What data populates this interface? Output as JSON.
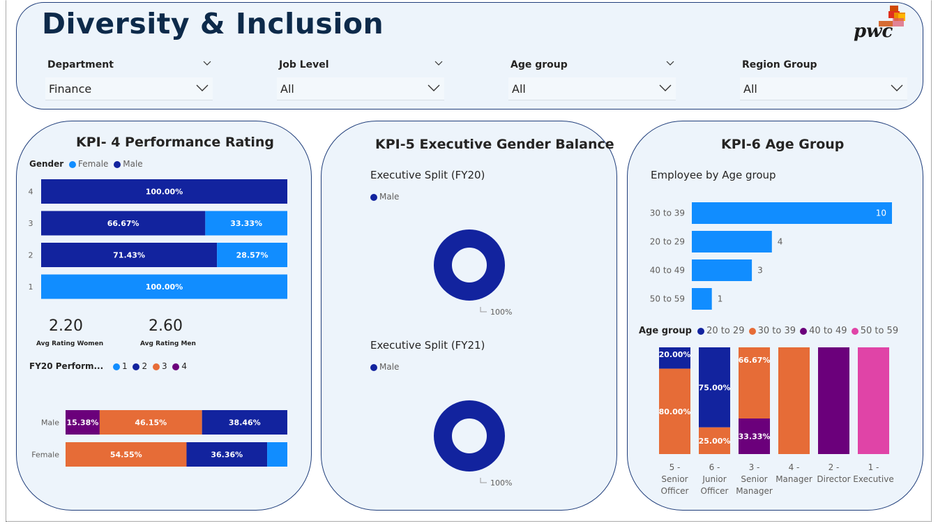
{
  "header": {
    "title": "Diversity & Inclusion",
    "logo_text": "pwc",
    "slicers": [
      {
        "label": "Department",
        "value": "Finance"
      },
      {
        "label": "Job Level",
        "value": "All"
      },
      {
        "label": "Age group",
        "value": "All"
      },
      {
        "label": "Region Group",
        "value": "All"
      }
    ]
  },
  "colors": {
    "female": "#118dff",
    "male": "#12239e",
    "orange": "#e66c37",
    "purple": "#6b007b",
    "pink": "#e044a7",
    "brand_red": "#d04a02",
    "brand_orange": "#eb8c00",
    "brand_yellow": "#ffb600"
  },
  "kpi4": {
    "title": "KPI- 4 Performance Rating",
    "legend_title": "Gender",
    "legend": [
      "Female",
      "Male"
    ],
    "avg_women_value": "2.20",
    "avg_women_label": "Avg Rating Women",
    "avg_men_value": "2.60",
    "avg_men_label": "Avg Rating Men",
    "legend2_title": "FY20 Perform...",
    "legend2": [
      "1",
      "2",
      "3",
      "4"
    ]
  },
  "kpi5": {
    "title": "KPI-5 Executive Gender Balance",
    "fy20_title": "Executive Split (FY20)",
    "fy21_title": "Executive Split (FY21)",
    "legend": "Male",
    "fy20_label": "100%",
    "fy21_label": "100%"
  },
  "kpi6": {
    "title": "KPI-6 Age Group",
    "sub_title": "Employee by Age group",
    "legend_title": "Age group",
    "legend": [
      "20 to 29",
      "30 to 39",
      "40 to 49",
      "50 to 59"
    ]
  },
  "chart_data": [
    {
      "type": "bar",
      "orientation": "horizontal",
      "stacked": "100%",
      "categories": [
        "4",
        "3",
        "2",
        "1"
      ],
      "series": [
        {
          "name": "Male",
          "values": [
            100.0,
            66.67,
            71.43,
            0
          ]
        },
        {
          "name": "Female",
          "values": [
            0,
            33.33,
            28.57,
            100.0
          ]
        }
      ],
      "labels": [
        [
          "100.00%",
          ""
        ],
        [
          "66.67%",
          "33.33%"
        ],
        [
          "71.43%",
          "28.57%"
        ],
        [
          "",
          "100.00%"
        ]
      ]
    },
    {
      "type": "bar",
      "orientation": "horizontal",
      "stacked": "100%",
      "categories": [
        "Male",
        "Female"
      ],
      "series": [
        {
          "name": "4",
          "values": [
            15.38,
            0
          ]
        },
        {
          "name": "3",
          "values": [
            46.15,
            54.55
          ]
        },
        {
          "name": "2",
          "values": [
            38.46,
            36.36
          ]
        },
        {
          "name": "1",
          "values": [
            0,
            9.09
          ]
        }
      ],
      "labels": [
        [
          "15.38%",
          "46.15%",
          "38.46%",
          ""
        ],
        [
          "",
          "54.55%",
          "36.36%",
          ""
        ]
      ]
    },
    {
      "type": "pie",
      "donut": true,
      "slices": [
        {
          "name": "Male",
          "value": 100
        }
      ]
    },
    {
      "type": "pie",
      "donut": true,
      "slices": [
        {
          "name": "Male",
          "value": 100
        }
      ]
    },
    {
      "type": "bar",
      "orientation": "horizontal",
      "categories": [
        "30 to 39",
        "20 to 29",
        "40 to 49",
        "50 to 59"
      ],
      "values": [
        10,
        4,
        3,
        1
      ]
    },
    {
      "type": "bar",
      "stacked": "100%",
      "categories": [
        "5 - Senior Officer",
        "6 - Junior Officer",
        "3 - Senior Manager",
        "4 - Manager",
        "2 - Director",
        "1 - Executive"
      ],
      "category_lines": [
        [
          "5 -",
          "Senior",
          "Officer"
        ],
        [
          "6 -",
          "Junior",
          "Officer"
        ],
        [
          "3 -",
          "Senior",
          "Manager"
        ],
        [
          "4 -",
          "Manager"
        ],
        [
          "2 -",
          "Director"
        ],
        [
          "1 -",
          "Executive"
        ]
      ],
      "series": [
        {
          "name": "20 to 29",
          "values": [
            20.0,
            75.0,
            0,
            0,
            0,
            0
          ]
        },
        {
          "name": "30 to 39",
          "values": [
            80.0,
            25.0,
            66.67,
            100,
            0,
            0
          ]
        },
        {
          "name": "40 to 49",
          "values": [
            0,
            0,
            33.33,
            0,
            100,
            0
          ]
        },
        {
          "name": "50 to 59",
          "values": [
            0,
            0,
            0,
            0,
            0,
            100
          ]
        }
      ],
      "labels": [
        [
          "20.00%",
          "80.00%",
          "",
          ""
        ],
        [
          "75.00%",
          "25.00%",
          "",
          ""
        ],
        [
          "",
          "66.67%",
          "33.33%",
          ""
        ],
        [
          "",
          "",
          "",
          ""
        ],
        [
          "",
          "",
          "",
          ""
        ],
        [
          "",
          "",
          "",
          ""
        ]
      ]
    }
  ]
}
